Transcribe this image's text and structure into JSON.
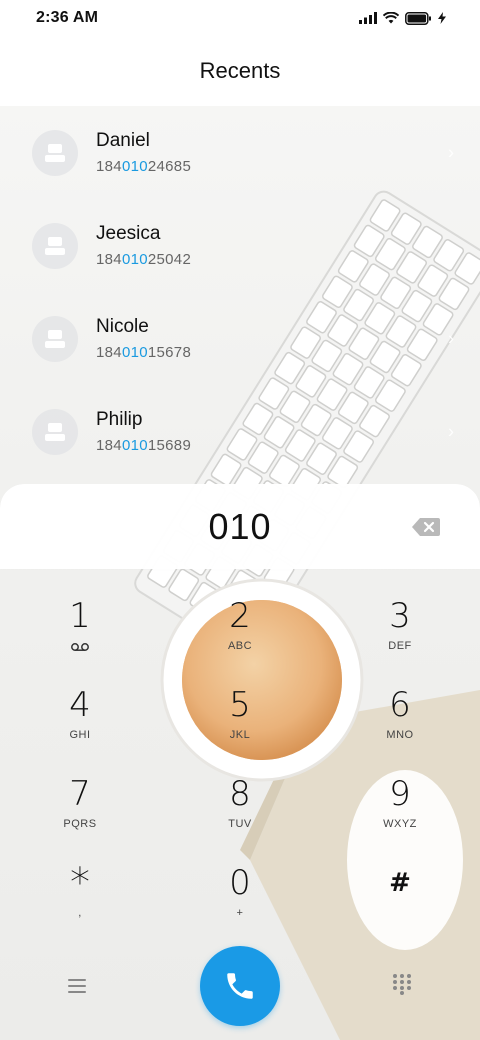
{
  "status_bar": {
    "time": "2:36 AM"
  },
  "header": {
    "title": "Recents"
  },
  "recents": [
    {
      "name": "Daniel",
      "number_prefix": "184",
      "number_match": "010",
      "number_suffix": "24685"
    },
    {
      "name": "Jeesica",
      "number_prefix": "184",
      "number_match": "010",
      "number_suffix": "25042"
    },
    {
      "name": "Nicole",
      "number_prefix": "184",
      "number_match": "010",
      "number_suffix": "15678"
    },
    {
      "name": "Philip",
      "number_prefix": "184",
      "number_match": "010",
      "number_suffix": "15689"
    }
  ],
  "dialer": {
    "display": "010",
    "keys": [
      {
        "digit": "1",
        "letters": ""
      },
      {
        "digit": "2",
        "letters": "ABC"
      },
      {
        "digit": "3",
        "letters": "DEF"
      },
      {
        "digit": "4",
        "letters": "GHI"
      },
      {
        "digit": "5",
        "letters": "JKL"
      },
      {
        "digit": "6",
        "letters": "MNO"
      },
      {
        "digit": "7",
        "letters": "PQRS"
      },
      {
        "digit": "8",
        "letters": "TUV"
      },
      {
        "digit": "9",
        "letters": "WXYZ"
      },
      {
        "digit": "*",
        "letters": ","
      },
      {
        "digit": "0",
        "letters": "+"
      },
      {
        "digit": "#",
        "letters": ""
      }
    ]
  },
  "colors": {
    "accent": "#1a9ae6",
    "highlight": "#1a9ae0"
  },
  "icons": {
    "status": [
      "signal-icon",
      "wifi-icon",
      "battery-icon",
      "charging-icon"
    ],
    "voicemail": "voicemail-icon",
    "backspace": "backspace-icon",
    "menu": "menu-icon",
    "call": "phone-icon",
    "dialpad": "dialpad-icon"
  }
}
